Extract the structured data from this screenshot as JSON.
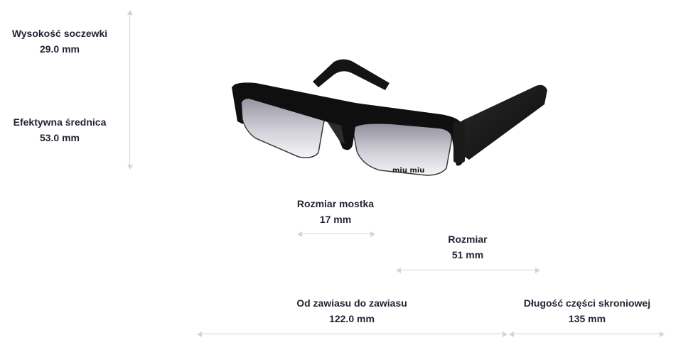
{
  "measurements": {
    "lens_height": {
      "label": "Wysokość soczewki",
      "value": "29.0 mm"
    },
    "effective_diameter": {
      "label": "Efektywna średnica",
      "value": "53.0 mm"
    },
    "bridge_size": {
      "label": "Rozmiar mostka",
      "value": "17 mm"
    },
    "size": {
      "label": "Rozmiar",
      "value": "51 mm"
    },
    "hinge_to_hinge": {
      "label": "Od zawiasu do zawiasu",
      "value": "122.0 mm"
    },
    "temple_length": {
      "label": "Długość części skroniowej",
      "value": "135 mm"
    }
  },
  "product": {
    "brand_logo_text": "miu miu",
    "image": "sunglasses-product-image"
  },
  "colors": {
    "text": "#1f2433",
    "guide_line": "#d4d4d4",
    "frame": "#111111"
  }
}
